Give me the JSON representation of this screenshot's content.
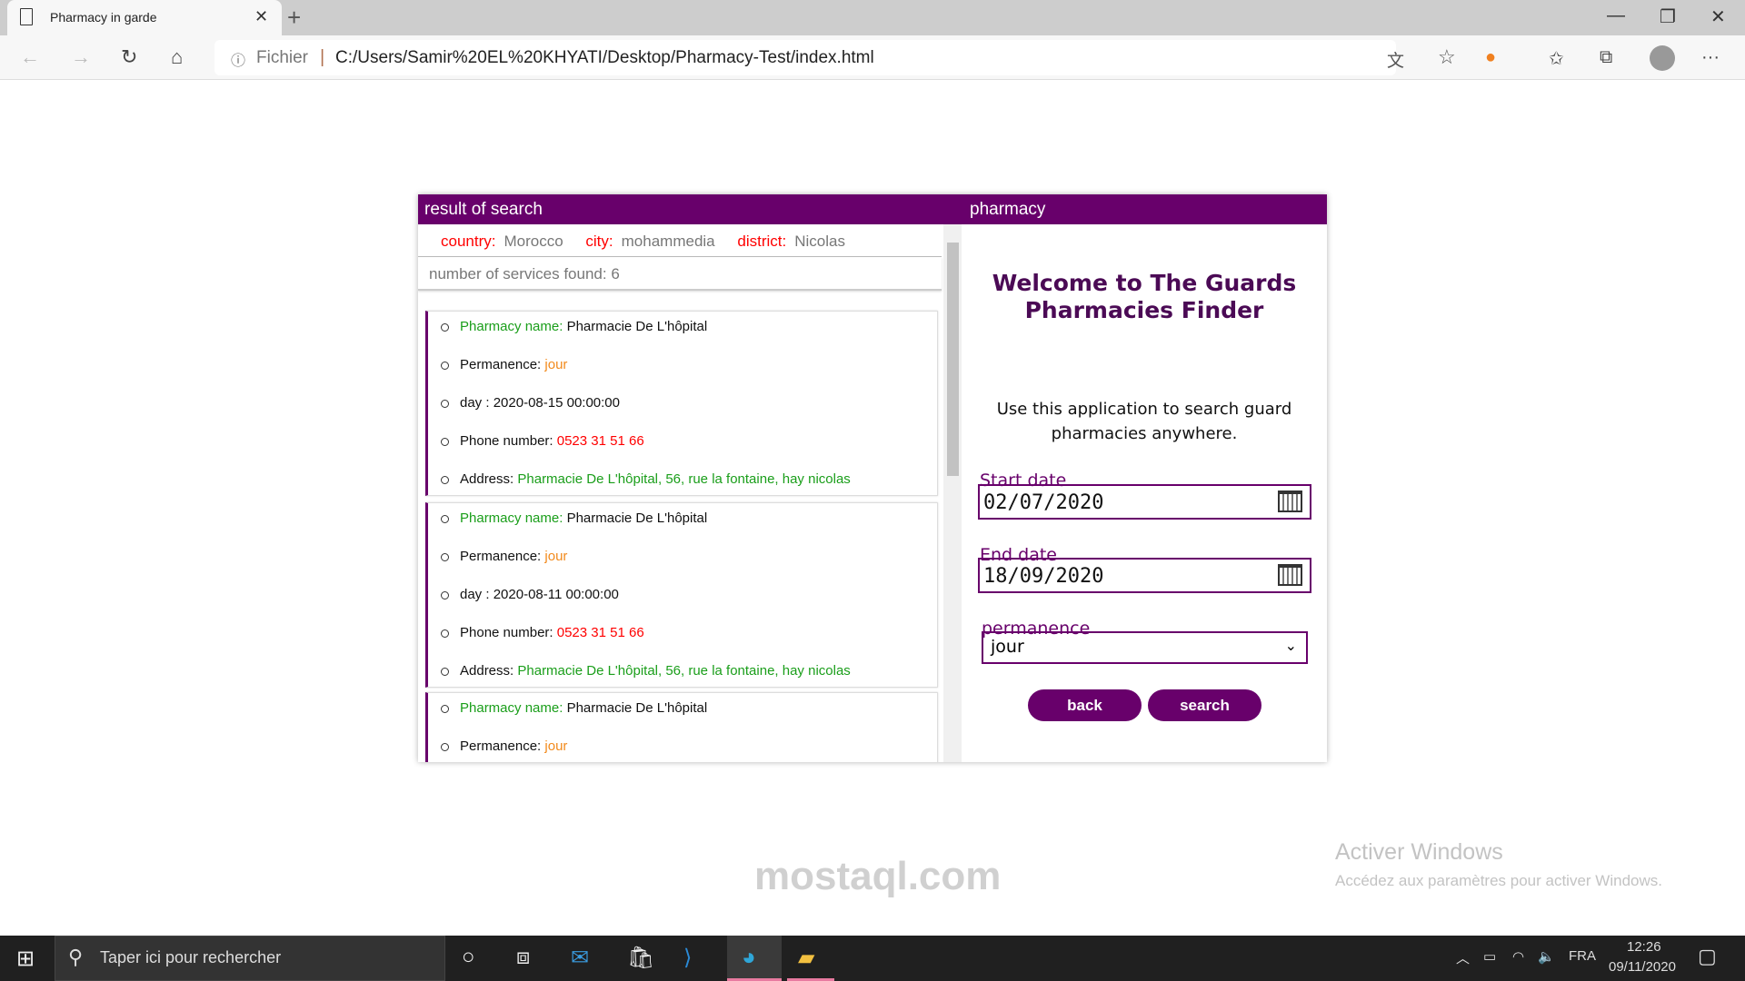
{
  "browser": {
    "tab_title": "Pharmacy in garde",
    "url_prefix": "Fichier",
    "url": "C:/Users/Samir%20EL%20KHYATI/Desktop/Pharmacy-Test/index.html"
  },
  "panel": {
    "left_header": "result of search",
    "right_header": "pharmacy"
  },
  "filters": {
    "country_label": "country:",
    "country": "Morocco",
    "city_label": "city:",
    "city": "mohammedia",
    "district_label": "district:",
    "district": "Nicolas"
  },
  "count_text": "number of services found: 6",
  "labels": {
    "name": "Pharmacy name:",
    "perm": "Permanence:",
    "day": "day :",
    "phone": "Phone number:",
    "address": "Address:"
  },
  "results": [
    {
      "name": "Pharmacie De L'hôpital",
      "permanence": "jour",
      "day": "2020-08-15 00:00:00",
      "phone": "0523 31 51 66",
      "address": "Pharmacie De L'hôpital, 56, rue la fontaine, hay nicolas"
    },
    {
      "name": "Pharmacie De L'hôpital",
      "permanence": "jour",
      "day": "2020-08-11 00:00:00",
      "phone": "0523 31 51 66",
      "address": "Pharmacie De L'hôpital, 56, rue la fontaine, hay nicolas"
    },
    {
      "name": "Pharmacie De L'hôpital",
      "permanence": "jour"
    }
  ],
  "form": {
    "welcome": "Welcome to The Guards Pharmacies Finder",
    "intro": "Use this application to search guard pharmacies anywhere.",
    "start_label": "Start date",
    "start_value": "02/07/2020",
    "end_label": "End date",
    "end_value": "18/09/2020",
    "perm_label": "permanence",
    "perm_value": "jour",
    "back": "back",
    "search": "search"
  },
  "watermark": {
    "line1": "Activer Windows",
    "line2": "Accédez aux paramètres pour activer Windows.",
    "logo": "مستقل mostaql.com"
  },
  "taskbar": {
    "search_placeholder": "Taper ici pour rechercher",
    "lang": "FRA",
    "time": "12:26",
    "date": "09/11/2020"
  },
  "colors": {
    "accent": "#68006b",
    "label_red": "#ff0000",
    "green": "#1a9e1a",
    "orange": "#f28a1c"
  }
}
